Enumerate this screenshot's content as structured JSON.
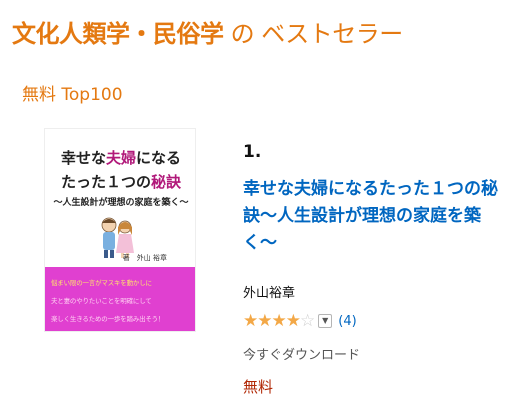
{
  "header": {
    "category": "文化人類学・民俗学",
    "suffix": " の ベストセラー"
  },
  "list": {
    "subheading": "無料 Top100"
  },
  "item": {
    "rank": "1.",
    "title": "幸せな夫婦になるたった１つの秘訣〜人生設計が理想の家庭を築く〜",
    "author": "外山裕章",
    "rating": {
      "stars": 4,
      "max": 5
    },
    "review_count": "(4)",
    "format": "今すぐダウンロード",
    "price": "無料",
    "cover": {
      "line1_a": "幸せな",
      "line1_b": "夫婦",
      "line1_c": "になる",
      "line2_a": "たった１つの",
      "line2_b": "秘訣",
      "line3": "〜人生設計が理想の家庭を築く〜",
      "author": "著　外山 裕章",
      "blurb1": "悩まい限の一言がマスキを動かしに",
      "blurb2": "夫と妻のやりたいことを明確にして",
      "blurb3": "楽しく生きるための一歩を踏み出そう！"
    }
  },
  "colors": {
    "accent": "#e47911",
    "link": "#0066c0",
    "price": "#b12704",
    "star": "#f3a847",
    "cover_band": "#e040d0"
  }
}
